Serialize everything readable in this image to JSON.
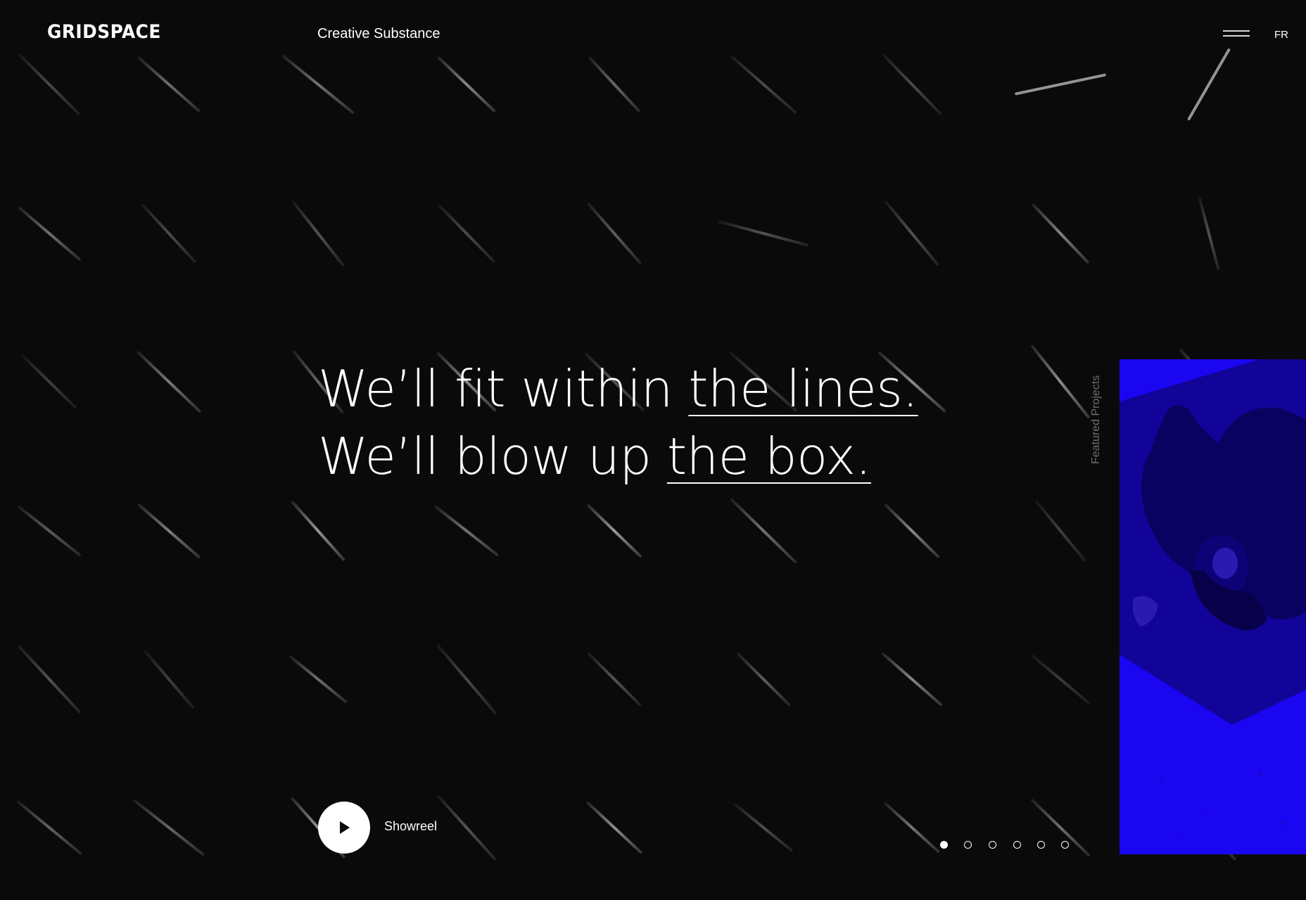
{
  "header": {
    "logo": "GRIDSPACE",
    "tagline": "Creative Substance",
    "language_label": "FR",
    "menu_icon": "hamburger-icon"
  },
  "hero": {
    "line1_plain": "We’ll fit within ",
    "line1_underlined": "the lines.",
    "line2_plain": "We’ll blow up ",
    "line2_underlined": "the box."
  },
  "showreel": {
    "label": "Showreel",
    "icon": "play-icon"
  },
  "pagination": {
    "count": 6,
    "active_index": 0
  },
  "featured": {
    "label": "Featured Projects",
    "image_description_icon": "person-lying-photo",
    "card_color": "#1a06f0"
  },
  "colors": {
    "background": "#0a0a0b",
    "text": "#ffffff",
    "muted": "#6e6e6e",
    "accent": "#1a06f0"
  }
}
